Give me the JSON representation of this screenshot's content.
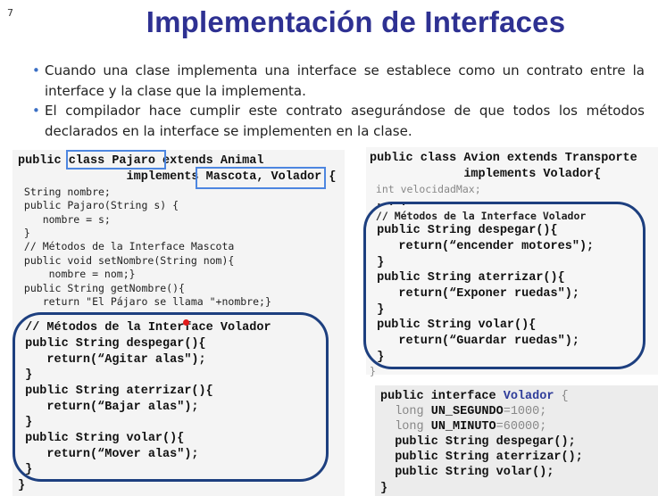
{
  "slide_number": "7",
  "title": "Implementación de Interfaces",
  "bullets": [
    "Cuando una clase implementa una interface se establece como un contrato entre la interface y la clase que la implementa.",
    "El compilador hace cumplir este contrato asegurándose de que todos los métodos declarados en la interface se implementen en la clase."
  ],
  "pajaro_code": [
    {
      "cls": "b md",
      "segs": [
        {
          "t": "public class Pajaro extends Animal"
        }
      ]
    },
    {
      "cls": "b md",
      "segs": [
        {
          "t": "               implements Mascota, Volador {"
        }
      ]
    },
    {
      "cls": "sm",
      "segs": [
        {
          "t": " String nombre;"
        }
      ]
    },
    {
      "cls": "sm",
      "segs": [
        {
          "t": " public Pajaro(String s) {"
        }
      ]
    },
    {
      "cls": "sm",
      "segs": [
        {
          "t": "    nombre = s;"
        }
      ]
    },
    {
      "cls": "sm",
      "segs": [
        {
          "t": " }"
        }
      ]
    },
    {
      "cls": "sm",
      "segs": [
        {
          "t": " // Métodos de la Interface Mascota"
        }
      ]
    },
    {
      "cls": "sm",
      "segs": [
        {
          "t": " public void setNombre(String nom){"
        }
      ]
    },
    {
      "cls": "sm",
      "segs": [
        {
          "t": "     nombre = nom;}"
        }
      ]
    },
    {
      "cls": "sm",
      "segs": [
        {
          "t": " public String getNombre(){"
        }
      ]
    },
    {
      "cls": "sm",
      "segs": [
        {
          "t": "    return \"El Pájaro se llama \"+nombre;}"
        }
      ]
    },
    {
      "cls": "b md",
      "segs": [
        {
          "t": " // Métodos de la Interface Volador"
        }
      ]
    },
    {
      "cls": "b md",
      "segs": [
        {
          "t": " public String despegar(){"
        }
      ]
    },
    {
      "cls": "b md",
      "segs": [
        {
          "t": "    return(“Agitar alas\");"
        }
      ]
    },
    {
      "cls": "b md",
      "segs": [
        {
          "t": " }"
        }
      ]
    },
    {
      "cls": "b md",
      "segs": [
        {
          "t": " public String aterrizar(){"
        }
      ]
    },
    {
      "cls": "b md",
      "segs": [
        {
          "t": "    return(“Bajar alas\");"
        }
      ]
    },
    {
      "cls": "b md",
      "segs": [
        {
          "t": " }"
        }
      ]
    },
    {
      "cls": "b md",
      "segs": [
        {
          "t": " public String volar(){"
        }
      ]
    },
    {
      "cls": "b md",
      "segs": [
        {
          "t": "    return(“Mover alas\");"
        }
      ]
    },
    {
      "cls": "b md",
      "segs": [
        {
          "t": " }"
        }
      ]
    },
    {
      "cls": "b md",
      "segs": [
        {
          "t": "}"
        }
      ]
    }
  ],
  "avion_code": [
    {
      "cls": "b md",
      "segs": [
        {
          "t": "public class Avion extends Transporte"
        }
      ]
    },
    {
      "cls": "b md",
      "segs": [
        {
          "t": "             implements Volador{"
        }
      ]
    },
    {
      "cls": "sm gray",
      "segs": [
        {
          "t": " int velocidadMax;"
        }
      ]
    },
    {
      "cls": "sm b",
      "segs": [
        {
          "t": " . . ."
        }
      ]
    },
    {
      "cls": "sm b",
      "segs": [
        {
          "t": " // Métodos de la Interface Volador"
        }
      ]
    },
    {
      "cls": "b md",
      "segs": [
        {
          "t": " public String despegar(){"
        }
      ]
    },
    {
      "cls": "b md",
      "segs": [
        {
          "t": "    return(“encender motores\");"
        }
      ]
    },
    {
      "cls": "b md",
      "segs": [
        {
          "t": " }"
        }
      ]
    },
    {
      "cls": "b md",
      "segs": [
        {
          "t": " public String aterrizar(){"
        }
      ]
    },
    {
      "cls": "b md",
      "segs": [
        {
          "t": "    return(“Exponer ruedas\");"
        }
      ]
    },
    {
      "cls": "b md",
      "segs": [
        {
          "t": " }"
        }
      ]
    },
    {
      "cls": "b md",
      "segs": [
        {
          "t": " public String volar(){"
        }
      ]
    },
    {
      "cls": "b md",
      "segs": [
        {
          "t": "    return(“Guardar ruedas\");"
        }
      ]
    },
    {
      "cls": "b md",
      "segs": [
        {
          "t": " }"
        }
      ]
    },
    {
      "cls": "sm gray",
      "segs": [
        {
          "t": "}"
        }
      ]
    }
  ],
  "interface_code": [
    {
      "cls": "b md",
      "segs": [
        {
          "t": "public interface "
        },
        {
          "t": "Volador",
          "c": "blue"
        },
        {
          "t": " {",
          "c": "gray"
        }
      ]
    },
    {
      "cls": "md",
      "segs": [
        {
          "t": "  long ",
          "c": "gray"
        },
        {
          "t": "UN_SEGUNDO",
          "c": "b"
        },
        {
          "t": "=1000;",
          "c": "gray"
        }
      ]
    },
    {
      "cls": "md",
      "segs": [
        {
          "t": "  long ",
          "c": "gray"
        },
        {
          "t": "UN_MINUTO",
          "c": "b"
        },
        {
          "t": "=60000;",
          "c": "gray"
        }
      ]
    },
    {
      "cls": "b md",
      "segs": [
        {
          "t": "  public String despegar();"
        }
      ]
    },
    {
      "cls": "b md",
      "segs": [
        {
          "t": "  public String aterrizar();"
        }
      ]
    },
    {
      "cls": "b md",
      "segs": [
        {
          "t": "  public String volar();"
        }
      ]
    },
    {
      "cls": "b md",
      "segs": [
        {
          "t": "}"
        }
      ]
    }
  ]
}
